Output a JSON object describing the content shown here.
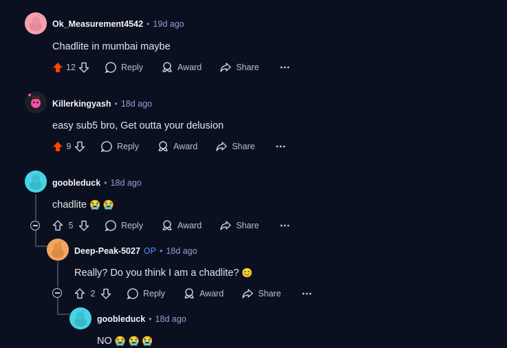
{
  "comments": [
    {
      "username": "Ok_Measurement4542",
      "time": "19d ago",
      "text": "Chadlite in mumbai maybe",
      "score": "12",
      "voted": "up",
      "reply": "Reply",
      "award": "Award",
      "share": "Share",
      "avatar_color": "#f4a0b0"
    },
    {
      "username": "Killerkingyash",
      "time": "18d ago",
      "text": "easy sub5 bro, Get outta your delusion",
      "score": "9",
      "voted": "up",
      "reply": "Reply",
      "award": "Award",
      "share": "Share",
      "avatar_color": "#2a2f3a"
    },
    {
      "username": "goobleduck",
      "time": "18d ago",
      "text": "chadlite",
      "emoji": "😭 😭",
      "score": "5",
      "voted": "none",
      "reply": "Reply",
      "award": "Award",
      "share": "Share",
      "avatar_color": "#46d4e6"
    },
    {
      "username": "Deep-Peak-5027",
      "op_badge": "OP",
      "time": "18d ago",
      "text": "Really? Do you think I am a chadlite?",
      "emoji": "😊",
      "score": "2",
      "voted": "none",
      "reply": "Reply",
      "award": "Award",
      "share": "Share",
      "avatar_color": "#f2a55e"
    },
    {
      "username": "goobleduck",
      "time": "18d ago",
      "text": "NO",
      "emoji": "😭 😭 😭",
      "avatar_color": "#46d4e6"
    }
  ],
  "colors": {
    "upvote_active": "#ff4500",
    "background": "#0b1020",
    "op": "#4f8dff"
  }
}
